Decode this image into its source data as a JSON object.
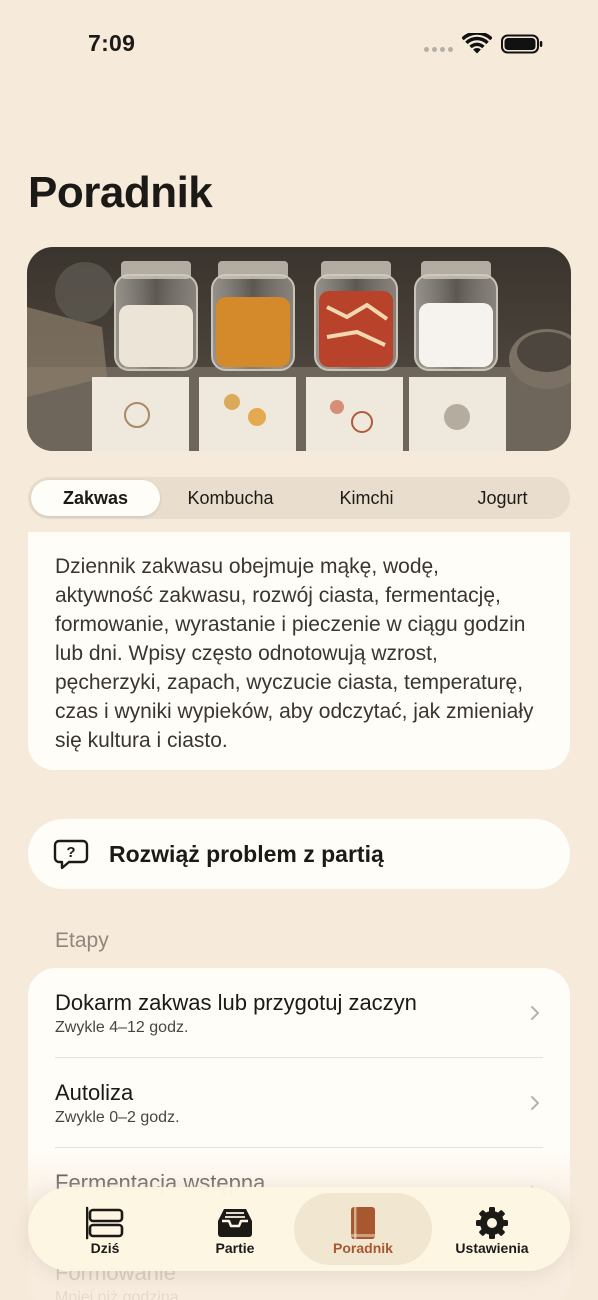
{
  "status_bar": {
    "time": "7:09"
  },
  "page": {
    "title": "Poradnik"
  },
  "segments": [
    {
      "label": "Zakwas",
      "active": true
    },
    {
      "label": "Kombucha",
      "active": false
    },
    {
      "label": "Kimchi",
      "active": false
    },
    {
      "label": "Jogurt",
      "active": false
    }
  ],
  "description": "Dziennik zakwasu obejmuje mąkę, wodę, aktywność zakwasu, rozwój ciasta, fermentację, formowanie, wyrastanie i pieczenie w ciągu godzin lub dni. Wpisy często odnotowują wzrost, pęcherzyki, zapach, wyczucie ciasta, temperaturę, czas i wyniki wypieków, aby odczytać, jak zmieniały się kultura i ciasto.",
  "troubleshoot": {
    "label": "Rozwiąż problem z partią",
    "icon": "question-bubble-icon"
  },
  "stages_section": {
    "header": "Etapy"
  },
  "stages": [
    {
      "title": "Dokarm zakwas lub przygotuj zaczyn",
      "subtitle": "Zwykle 4–12 godz."
    },
    {
      "title": "Autoliza",
      "subtitle": "Zwykle 0–2 godz."
    },
    {
      "title": "Fermentacja wstępna",
      "subtitle": ""
    },
    {
      "title": "Formowanie",
      "subtitle": "Mniej niż godzina"
    }
  ],
  "tabs": [
    {
      "label": "Dziś",
      "icon": "timeline-icon",
      "active": false
    },
    {
      "label": "Partie",
      "icon": "tray-icon",
      "active": false
    },
    {
      "label": "Poradnik",
      "icon": "book-icon",
      "active": true
    },
    {
      "label": "Ustawienia",
      "icon": "gear-icon",
      "active": false
    }
  ],
  "colors": {
    "accent": "#a8582f",
    "background": "#f6eadb",
    "card": "#fffdf8"
  }
}
